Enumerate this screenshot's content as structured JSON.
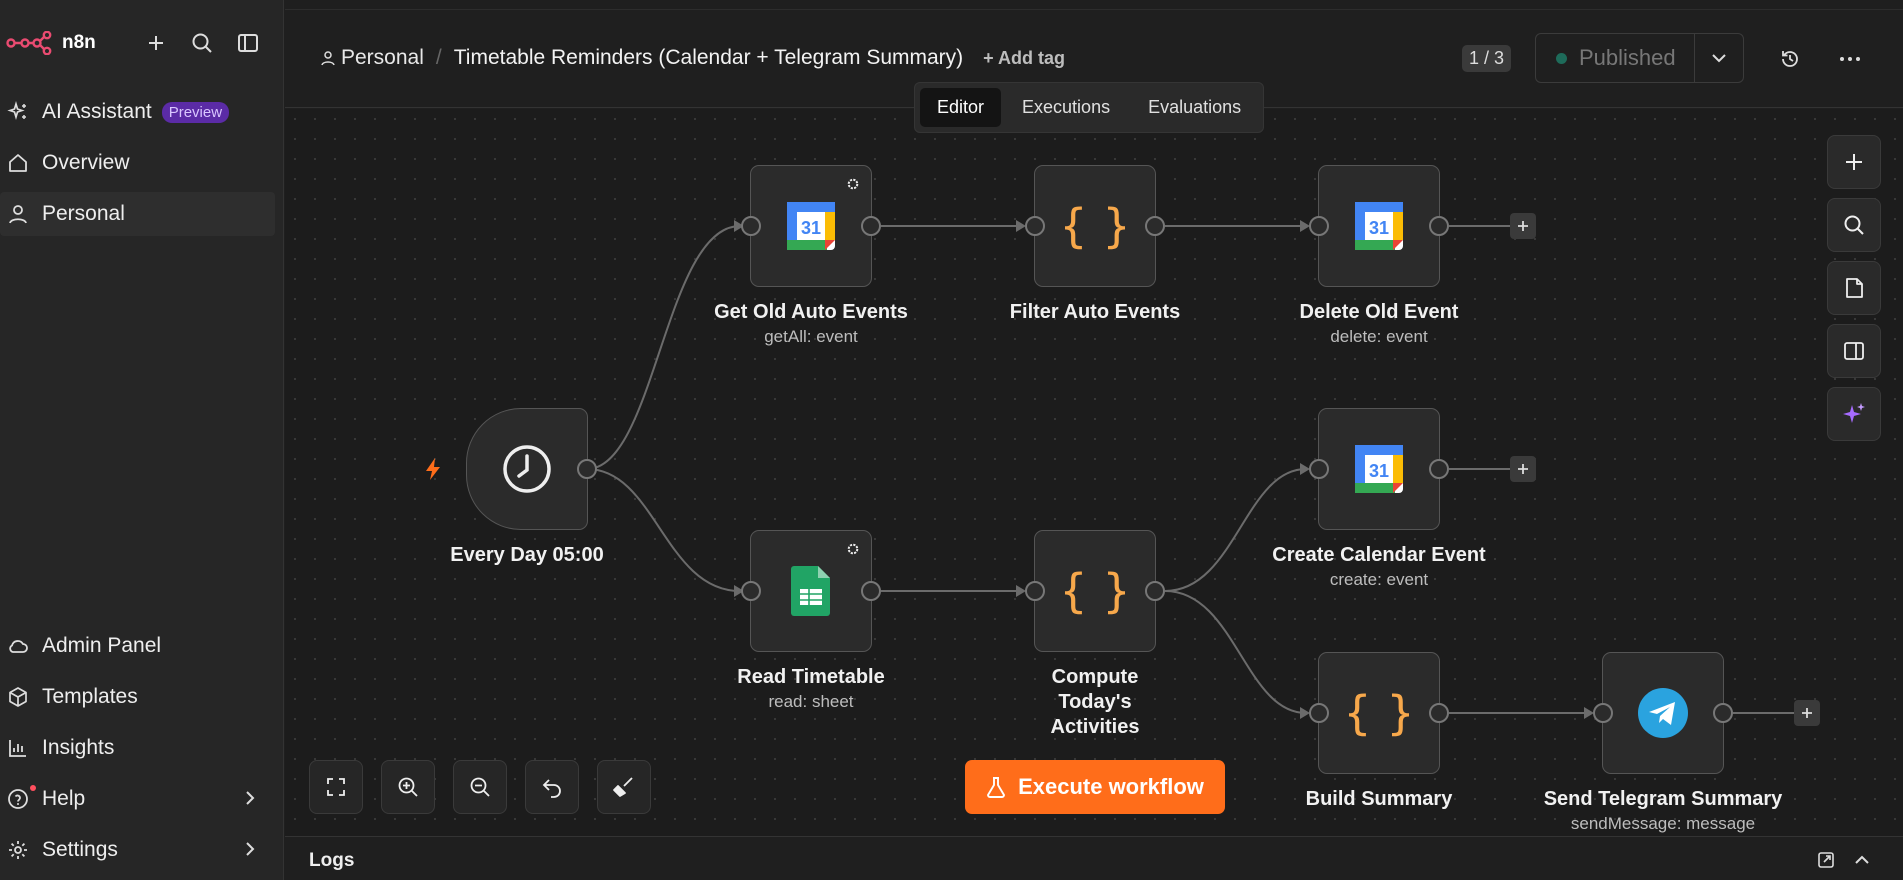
{
  "sidebar": {
    "brand": "n8n",
    "items": [
      {
        "label": "AI Assistant",
        "badge": "Preview"
      },
      {
        "label": "Overview"
      },
      {
        "label": "Personal"
      }
    ],
    "bottom_items": [
      {
        "label": "Admin Panel"
      },
      {
        "label": "Templates"
      },
      {
        "label": "Insights"
      },
      {
        "label": "Help"
      },
      {
        "label": "Settings"
      }
    ]
  },
  "header": {
    "project": "Personal",
    "separator": "/",
    "workflow_title": "Timetable Reminders (Calendar + Telegram Summary)",
    "add_tag": "+ Add tag",
    "version_counter": "1 / 3",
    "publish_status": "Published",
    "status_color": "#1e6b5a"
  },
  "tabs": [
    {
      "label": "Editor",
      "active": true
    },
    {
      "label": "Executions",
      "active": false
    },
    {
      "label": "Evaluations",
      "active": false
    }
  ],
  "nodes": {
    "trigger": {
      "title": "Every Day 05:00"
    },
    "get_old": {
      "title": "Get Old Auto Events",
      "subtitle": "getAll: event"
    },
    "filter": {
      "title": "Filter Auto Events"
    },
    "delete": {
      "title": "Delete Old Event",
      "subtitle": "delete: event"
    },
    "read": {
      "title": "Read Timetable",
      "subtitle": "read: sheet"
    },
    "compute": {
      "title": "Compute Today's Activities"
    },
    "create": {
      "title": "Create Calendar Event",
      "subtitle": "create: event"
    },
    "build": {
      "title": "Build Summary"
    },
    "telegram": {
      "title": "Send Telegram Summary",
      "subtitle": "sendMessage: message"
    }
  },
  "execute_button": "Execute workflow",
  "logs": {
    "title": "Logs"
  },
  "colors": {
    "accent": "#ff6d1a",
    "code_icon": "#f7a84b",
    "telegram": "#2aa3df",
    "sheets": "#21a465"
  }
}
